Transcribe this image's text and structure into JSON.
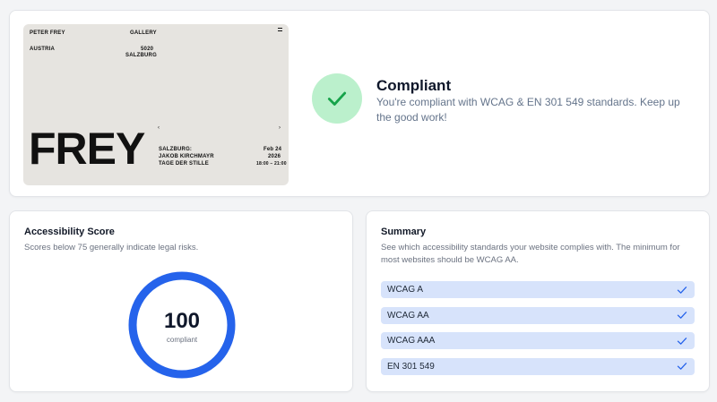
{
  "preview": {
    "header_left": "PETER FREY",
    "header_center": "GALLERY",
    "location_left": "AUSTRIA",
    "postcode": "5020",
    "city": "SALZBURG",
    "big_word": "FREY",
    "event_city": "SALZBURG:",
    "event_artist": "JAKOB KIRCHMAYR",
    "event_title": "TAGE DER STILLE",
    "event_date": "Feb 24",
    "event_year": "2026",
    "event_time": "18:00 – 21:00",
    "arrow_left": "‹",
    "arrow_right": "›"
  },
  "status": {
    "title": "Compliant",
    "message": "You're compliant with WCAG & EN 301 549 standards. Keep up the good work!",
    "icon": "check-icon",
    "badge_color": "#bbf0cc",
    "check_color": "#16a34a"
  },
  "score": {
    "title": "Accessibility Score",
    "subtitle": "Scores below 75 generally indicate legal risks.",
    "value": "100",
    "label": "compliant",
    "fraction": 1.0,
    "ring_color": "#2563eb"
  },
  "summary": {
    "title": "Summary",
    "subtitle": "See which accessibility standards your website complies with. The minimum for most websites should be WCAG AA.",
    "standards": [
      {
        "label": "WCAG A",
        "passed": true
      },
      {
        "label": "WCAG AA",
        "passed": true
      },
      {
        "label": "WCAG AAA",
        "passed": true
      },
      {
        "label": "EN 301 549",
        "passed": true
      }
    ],
    "row_color": "#d7e3fb",
    "check_color": "#2563eb"
  }
}
